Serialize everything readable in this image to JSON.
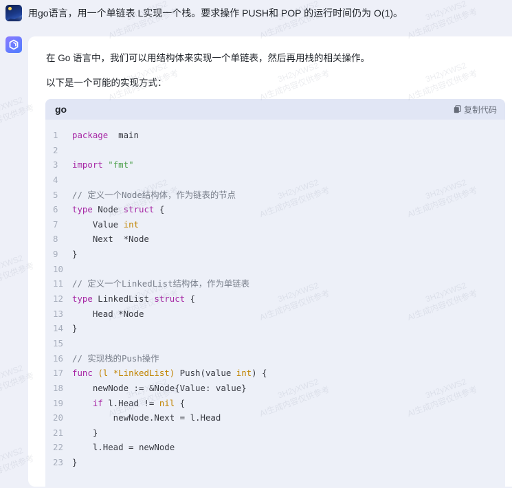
{
  "user_message": {
    "avatar": "user-avatar-night-scene",
    "text": "用go语言，用一个单链表 L实现一个栈。要求操作 PUSH和 POP 的运行时间仍为 O(1)。"
  },
  "assistant": {
    "avatar": "assistant-logo-icon",
    "paragraphs": [
      "在 Go 语言中，我们可以用结构体来实现一个单链表，然后再用栈的相关操作。",
      "以下是一个可能的实现方式："
    ],
    "code_block": {
      "language": "go",
      "copy_label": "复制代码",
      "copy_icon": "copy-icon",
      "lines": [
        {
          "n": "1",
          "tokens": [
            [
              "kw",
              "package"
            ],
            [
              "",
              "  main"
            ]
          ]
        },
        {
          "n": "2",
          "tokens": []
        },
        {
          "n": "3",
          "tokens": [
            [
              "kw",
              "import"
            ],
            [
              "",
              " "
            ],
            [
              "st",
              "\"fmt\""
            ]
          ]
        },
        {
          "n": "4",
          "tokens": []
        },
        {
          "n": "5",
          "tokens": [
            [
              "cm",
              "// 定义一个Node结构体，作为链表的节点"
            ]
          ]
        },
        {
          "n": "6",
          "tokens": [
            [
              "kw",
              "type"
            ],
            [
              "",
              " Node "
            ],
            [
              "kw",
              "struct"
            ],
            [
              "",
              " {"
            ]
          ]
        },
        {
          "n": "7",
          "tokens": [
            [
              "",
              "    Value "
            ],
            [
              "ty",
              "int"
            ]
          ]
        },
        {
          "n": "8",
          "tokens": [
            [
              "",
              "    Next  *Node"
            ]
          ]
        },
        {
          "n": "9",
          "tokens": [
            [
              "",
              "}"
            ]
          ]
        },
        {
          "n": "10",
          "tokens": []
        },
        {
          "n": "11",
          "tokens": [
            [
              "cm",
              "// 定义一个LinkedList结构体，作为单链表"
            ]
          ]
        },
        {
          "n": "12",
          "tokens": [
            [
              "kw",
              "type"
            ],
            [
              "",
              " LinkedList "
            ],
            [
              "kw",
              "struct"
            ],
            [
              "",
              " {"
            ]
          ]
        },
        {
          "n": "13",
          "tokens": [
            [
              "",
              "    Head *Node"
            ]
          ]
        },
        {
          "n": "14",
          "tokens": [
            [
              "",
              "}"
            ]
          ]
        },
        {
          "n": "15",
          "tokens": []
        },
        {
          "n": "16",
          "tokens": [
            [
              "cm",
              "// 实现栈的Push操作"
            ]
          ]
        },
        {
          "n": "17",
          "tokens": [
            [
              "kw",
              "func"
            ],
            [
              "",
              " "
            ],
            [
              "ty",
              "(l *LinkedList)"
            ],
            [
              "",
              " Push(value "
            ],
            [
              "ty",
              "int"
            ],
            [
              "",
              ") {"
            ]
          ]
        },
        {
          "n": "18",
          "tokens": [
            [
              "",
              "    newNode := &Node{Value: value}"
            ]
          ]
        },
        {
          "n": "19",
          "tokens": [
            [
              "",
              "    "
            ],
            [
              "kw",
              "if"
            ],
            [
              "",
              " l.Head != "
            ],
            [
              "ty",
              "nil"
            ],
            [
              "",
              " {"
            ]
          ]
        },
        {
          "n": "20",
          "tokens": [
            [
              "",
              "        newNode.Next = l.Head"
            ]
          ]
        },
        {
          "n": "21",
          "tokens": [
            [
              "",
              "    }"
            ]
          ]
        },
        {
          "n": "22",
          "tokens": [
            [
              "",
              "    l.Head = newNode"
            ]
          ]
        },
        {
          "n": "23",
          "tokens": [
            [
              "",
              "}"
            ]
          ]
        }
      ]
    }
  },
  "watermark": {
    "line1": "3H2yXWS2",
    "line2": "AI生成内容仅供参考"
  }
}
